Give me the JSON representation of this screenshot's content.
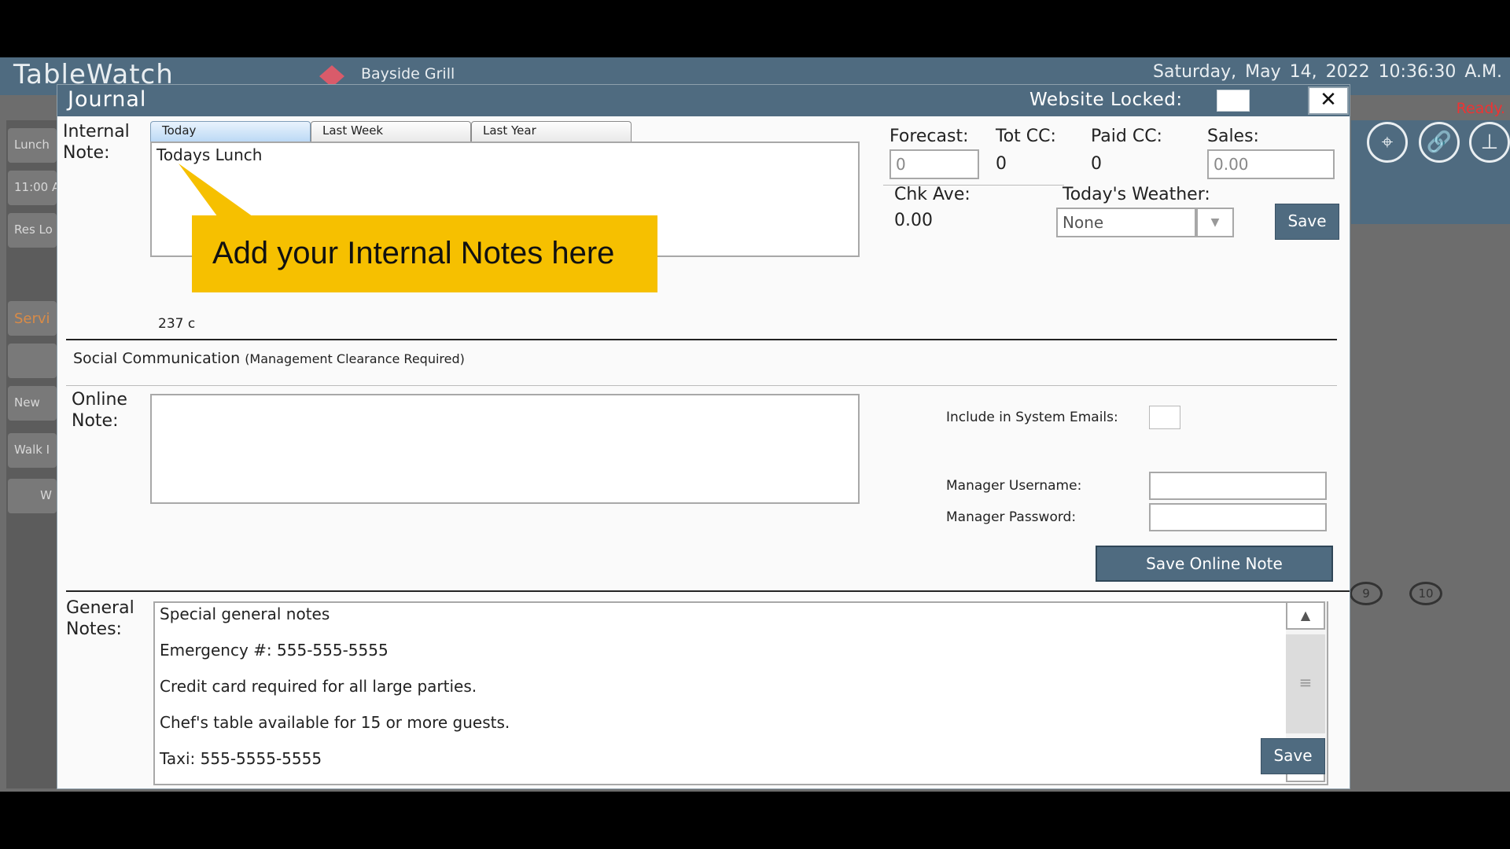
{
  "app": {
    "title": "TableWatch",
    "restaurant": "Bayside Grill",
    "datetime": "Saturday, May 14, 2022  10:36:30 A.M.",
    "status": "Ready."
  },
  "sidebar": {
    "items": [
      "Lunch",
      "11:00 A",
      "Res Lo",
      "Servi",
      "New",
      "Walk I",
      "W"
    ]
  },
  "background_tables": [
    "9",
    "10"
  ],
  "dialog": {
    "title": "Journal",
    "website_locked_label": "Website Locked:",
    "close_symbol": "✕",
    "tabs": [
      "Today",
      "Last Week",
      "Last Year"
    ],
    "internal_note_label": "Internal Note:",
    "internal_note_value": "Todays Lunch",
    "char_count": "237 c",
    "forecast_label": "Forecast:",
    "forecast_value": "0",
    "tot_cc_label": "Tot CC:",
    "tot_cc_value": "0",
    "paid_cc_label": "Paid CC:",
    "paid_cc_value": "0",
    "sales_label": "Sales:",
    "sales_value": "0.00",
    "chk_ave_label": "Chk Ave:",
    "chk_ave_value": "0.00",
    "weather_label": "Today's Weather:",
    "weather_value": "None",
    "save_label": "Save",
    "social_label": "Social Communication",
    "social_note": "(Management Clearance Required)",
    "online_note_label": "Online Note:",
    "include_emails_label": "Include in System Emails:",
    "manager_username_label": "Manager Username:",
    "manager_password_label": "Manager Password:",
    "save_online_label": "Save Online Note",
    "general_notes_label": "General Notes:",
    "general_notes": [
      "Special general notes",
      "Emergency #: 555-555-5555",
      "Credit card required for all large parties.",
      "Chef's table available for 15 or more guests.",
      "Taxi: 555-5555-5555"
    ],
    "general_save_label": "Save"
  },
  "callout": {
    "text": "Add your Internal Notes here"
  },
  "colors": {
    "header": "#4f6b80",
    "callout": "#f6c000",
    "status": "#e33333"
  }
}
